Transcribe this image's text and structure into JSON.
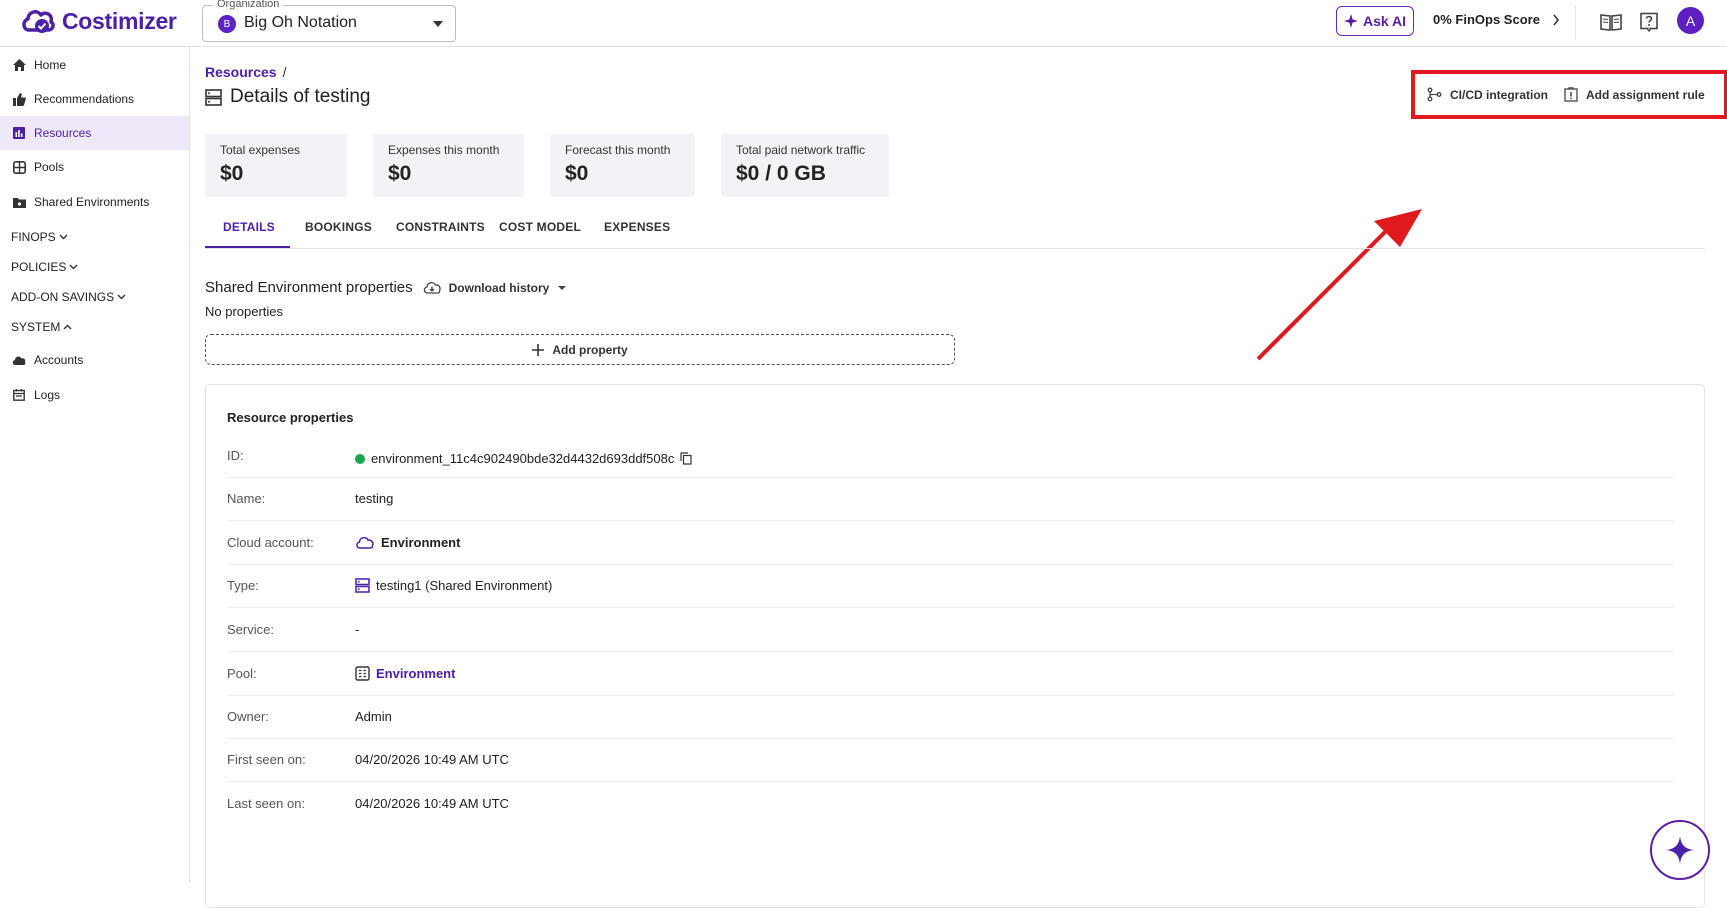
{
  "app": {
    "name": "Costimizer"
  },
  "org": {
    "legend": "Organization",
    "avatar_letter": "B",
    "name": "Big Oh Notation"
  },
  "header": {
    "ask_ai": "Ask AI",
    "finops_score": "0% FinOps Score",
    "user_initial": "A"
  },
  "sidebar": {
    "items": [
      {
        "label": "Home",
        "icon": "home-icon"
      },
      {
        "label": "Recommendations",
        "icon": "thumbs-up-icon"
      },
      {
        "label": "Resources",
        "icon": "bar-chart-icon",
        "active": true
      },
      {
        "label": "Pools",
        "icon": "pool-icon"
      },
      {
        "label": "Shared Environments",
        "icon": "folder-icon"
      }
    ],
    "sections": [
      {
        "label": "FINOPS",
        "expanded": false
      },
      {
        "label": "POLICIES",
        "expanded": false
      },
      {
        "label": "ADD-ON SAVINGS",
        "expanded": false
      },
      {
        "label": "SYSTEM",
        "expanded": true
      }
    ],
    "system_items": [
      {
        "label": "Accounts",
        "icon": "cloud-icon"
      },
      {
        "label": "Logs",
        "icon": "calendar-icon"
      }
    ]
  },
  "breadcrumb": {
    "parent": "Resources",
    "separator": "/"
  },
  "page": {
    "title": "Details of testing"
  },
  "actions": {
    "cicd": "CI/CD integration",
    "assignment": "Add assignment rule"
  },
  "kpis": [
    {
      "label": "Total expenses",
      "value": "$0"
    },
    {
      "label": "Expenses this month",
      "value": "$0"
    },
    {
      "label": "Forecast this month",
      "value": "$0"
    },
    {
      "label": "Total paid network traffic",
      "value": "$0 / 0 GB"
    }
  ],
  "tabs": [
    "DETAILS",
    "BOOKINGS",
    "CONSTRAINTS",
    "COST MODEL",
    "EXPENSES"
  ],
  "shared_env": {
    "title": "Shared Environment properties",
    "download_history": "Download history",
    "no_properties": "No properties",
    "add_property": "Add property"
  },
  "resource_properties": {
    "title": "Resource properties",
    "rows": [
      {
        "key": "ID:",
        "value": "environment_11c4c902490bde32d4432d693ddf508c"
      },
      {
        "key": "Name:",
        "value": "testing"
      },
      {
        "key": "Cloud account:",
        "value": "Environment"
      },
      {
        "key": "Type:",
        "value": "testing1 (Shared Environment)"
      },
      {
        "key": "Service:",
        "value": "-"
      },
      {
        "key": "Pool:",
        "value": "Environment"
      },
      {
        "key": "Owner:",
        "value": "Admin"
      },
      {
        "key": "First seen on:",
        "value": "04/20/2026 10:49 AM UTC"
      },
      {
        "key": "Last seen on:",
        "value": "04/20/2026 10:49 AM UTC"
      }
    ]
  },
  "colors": {
    "brand": "#4b1fa6",
    "highlight": "#e0191c",
    "status_green": "#1aa64a"
  }
}
